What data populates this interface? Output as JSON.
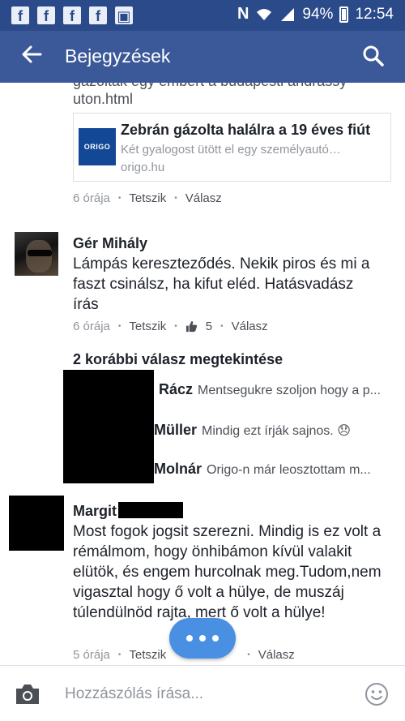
{
  "status_bar": {
    "signal_letter": "N",
    "battery": "94%",
    "time": "12:54"
  },
  "app_bar": {
    "title": "Bejegyzések"
  },
  "post": {
    "cut_text": "gázolták egy embert a budapesti andrassy",
    "link_text": "uton.html",
    "preview": {
      "logo_text": "ORIGO",
      "title": "Zebrán gázolta halálra a 19 éves fiút",
      "description": "Két gyalogost ütött el egy személyautó…",
      "domain": "origo.hu"
    },
    "meta": {
      "time": "6 órája",
      "like": "Tetszik",
      "reply": "Válasz"
    }
  },
  "comment1": {
    "author": "Gér Mihály",
    "body": "Lámpás kereszteződés. Nekik piros és mi a faszt csinálsz, ha kifut eléd. Hatásvadász írás",
    "meta": {
      "time": "6 órája",
      "like": "Tetszik",
      "like_count": "5",
      "reply": "Válasz"
    }
  },
  "replies": {
    "more_label": "2 korábbi válasz megtekintése",
    "items": [
      {
        "name": "Rácz",
        "text": "Mentsegukre szoljon hogy a p..."
      },
      {
        "name": "Müller",
        "text": "Mindig ezt írják sajnos. 😞"
      },
      {
        "name": "Molnár",
        "text": "Origo-n már leosztottam m..."
      }
    ]
  },
  "comment2": {
    "author": "Margit",
    "body": "Most fogok jogsit szerezni. Mindig is ez volt a rémálmom, hogy önhibámon kívül valakit elütök, és engem hurcolnak meg.Tudom,nem vigasztal hogy ő volt a hülye, de muszáj túlendülnöd rajta, mert ő volt a hülye!",
    "meta": {
      "time": "5 órája",
      "like": "Tetszik",
      "reply": "Válasz"
    }
  },
  "composer": {
    "placeholder": "Hozzászólás írása..."
  },
  "colors": {
    "header": "#3b5998",
    "status": "#2b4a8a",
    "fab": "#4a90e2"
  }
}
